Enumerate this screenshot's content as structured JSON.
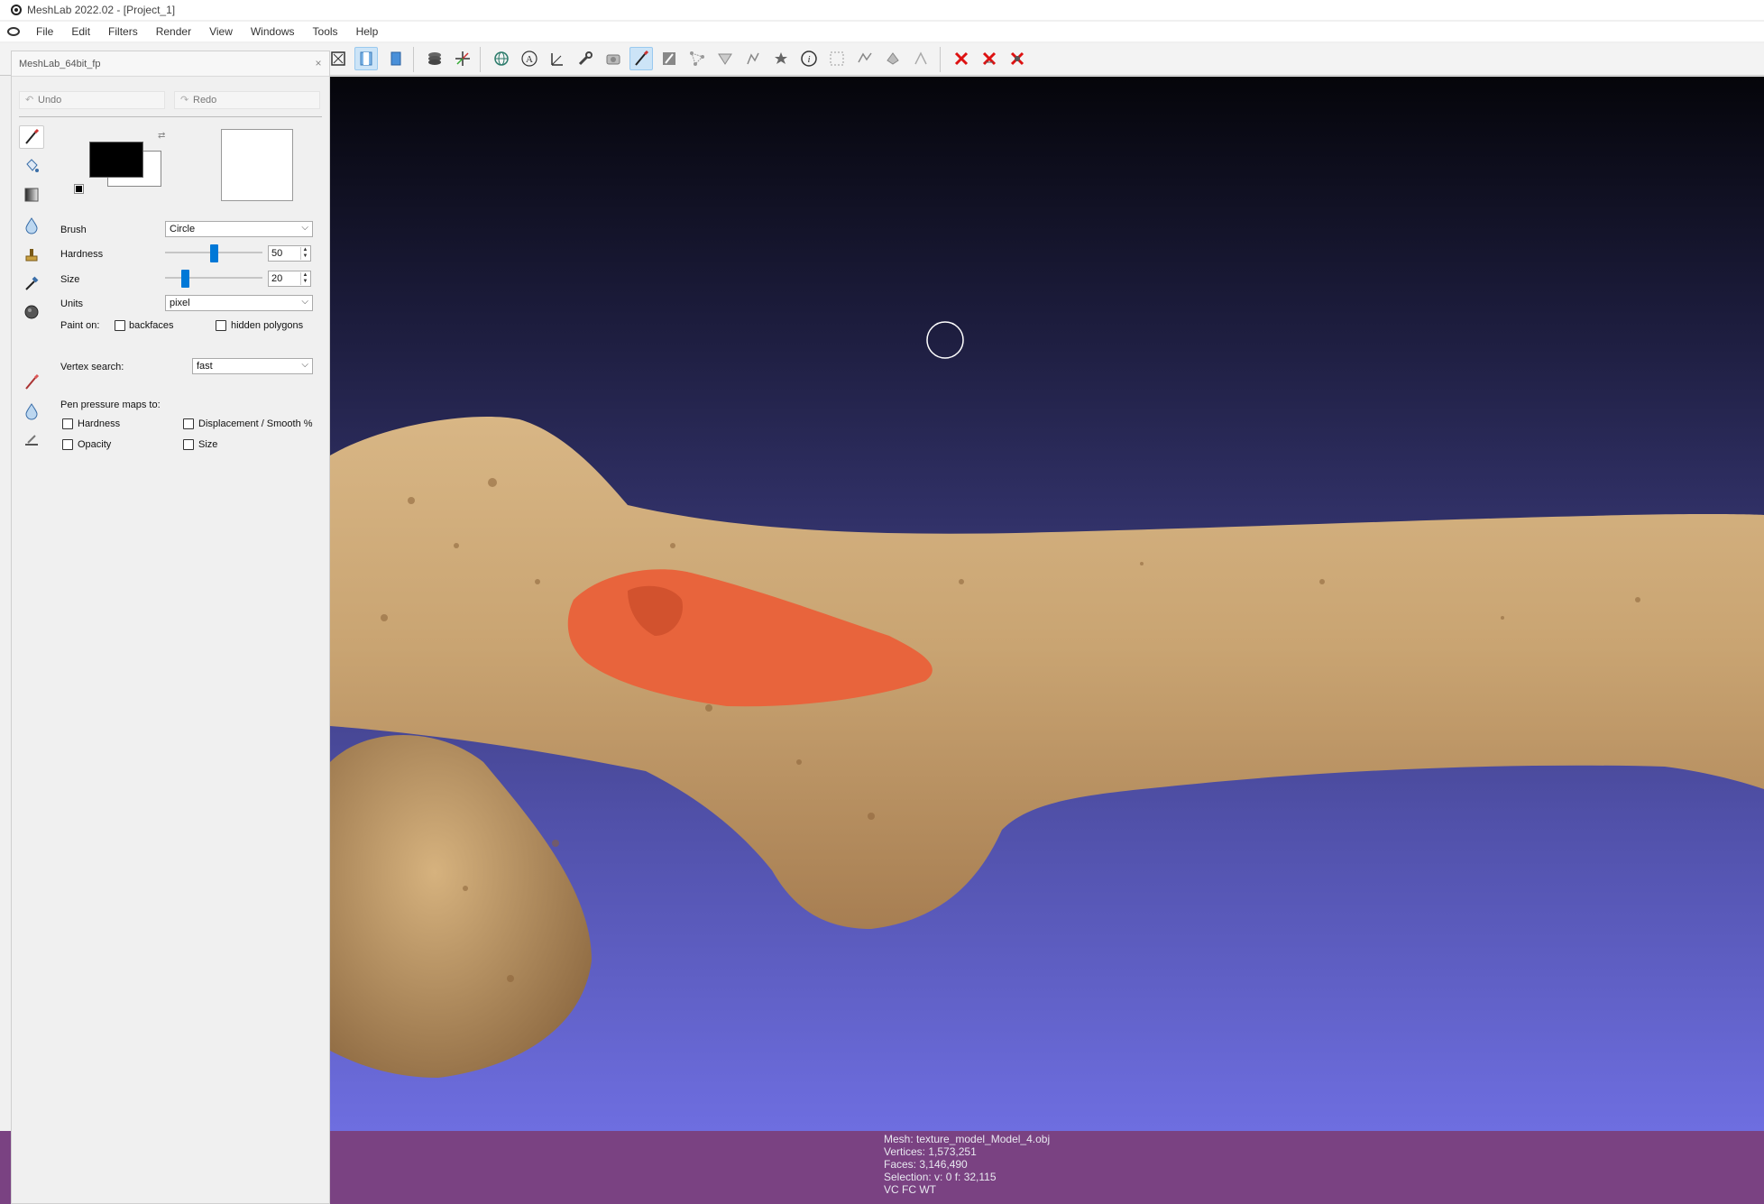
{
  "window": {
    "title": "MeshLab 2022.02 - [Project_1]"
  },
  "menu": {
    "items": [
      "File",
      "Edit",
      "Filters",
      "Render",
      "View",
      "Windows",
      "Tools",
      "Help"
    ]
  },
  "panel": {
    "title": "MeshLab_64bit_fp",
    "undo_label": "Undo",
    "redo_label": "Redo",
    "foreground_color": "#000000",
    "background_color": "#ffffff",
    "brush": {
      "label": "Brush",
      "value": "Circle"
    },
    "hardness": {
      "label": "Hardness",
      "value": "50",
      "fraction": 0.5
    },
    "size": {
      "label": "Size",
      "value": "20",
      "fraction": 0.2
    },
    "units": {
      "label": "Units",
      "value": "pixel"
    },
    "paint_on": {
      "label": "Paint on:",
      "backfaces": "backfaces",
      "hidden_polygons": "hidden polygons"
    },
    "vertex_search": {
      "label": "Vertex search:",
      "value": "fast"
    },
    "pen_pressure": {
      "label": "Pen pressure maps to:",
      "hardness": "Hardness",
      "displacement": "Displacement / Smooth %",
      "opacity": "Opacity",
      "size": "Size"
    }
  },
  "mesh_info": {
    "mesh": "Mesh: texture_model_Model_4.obj",
    "vertices": "Vertices: 1,573,251",
    "faces": "Faces: 3,146,490",
    "selection": "Selection: v: 0 f: 32,115",
    "flags": "VC FC WT"
  },
  "colors": {
    "viewport_top": "#05050a",
    "viewport_bottom": "#6e6ee0",
    "status_strip": "#7a4282",
    "bone": "#c9a472",
    "painted_region": "#e8643c",
    "accent": "#0078d7"
  }
}
